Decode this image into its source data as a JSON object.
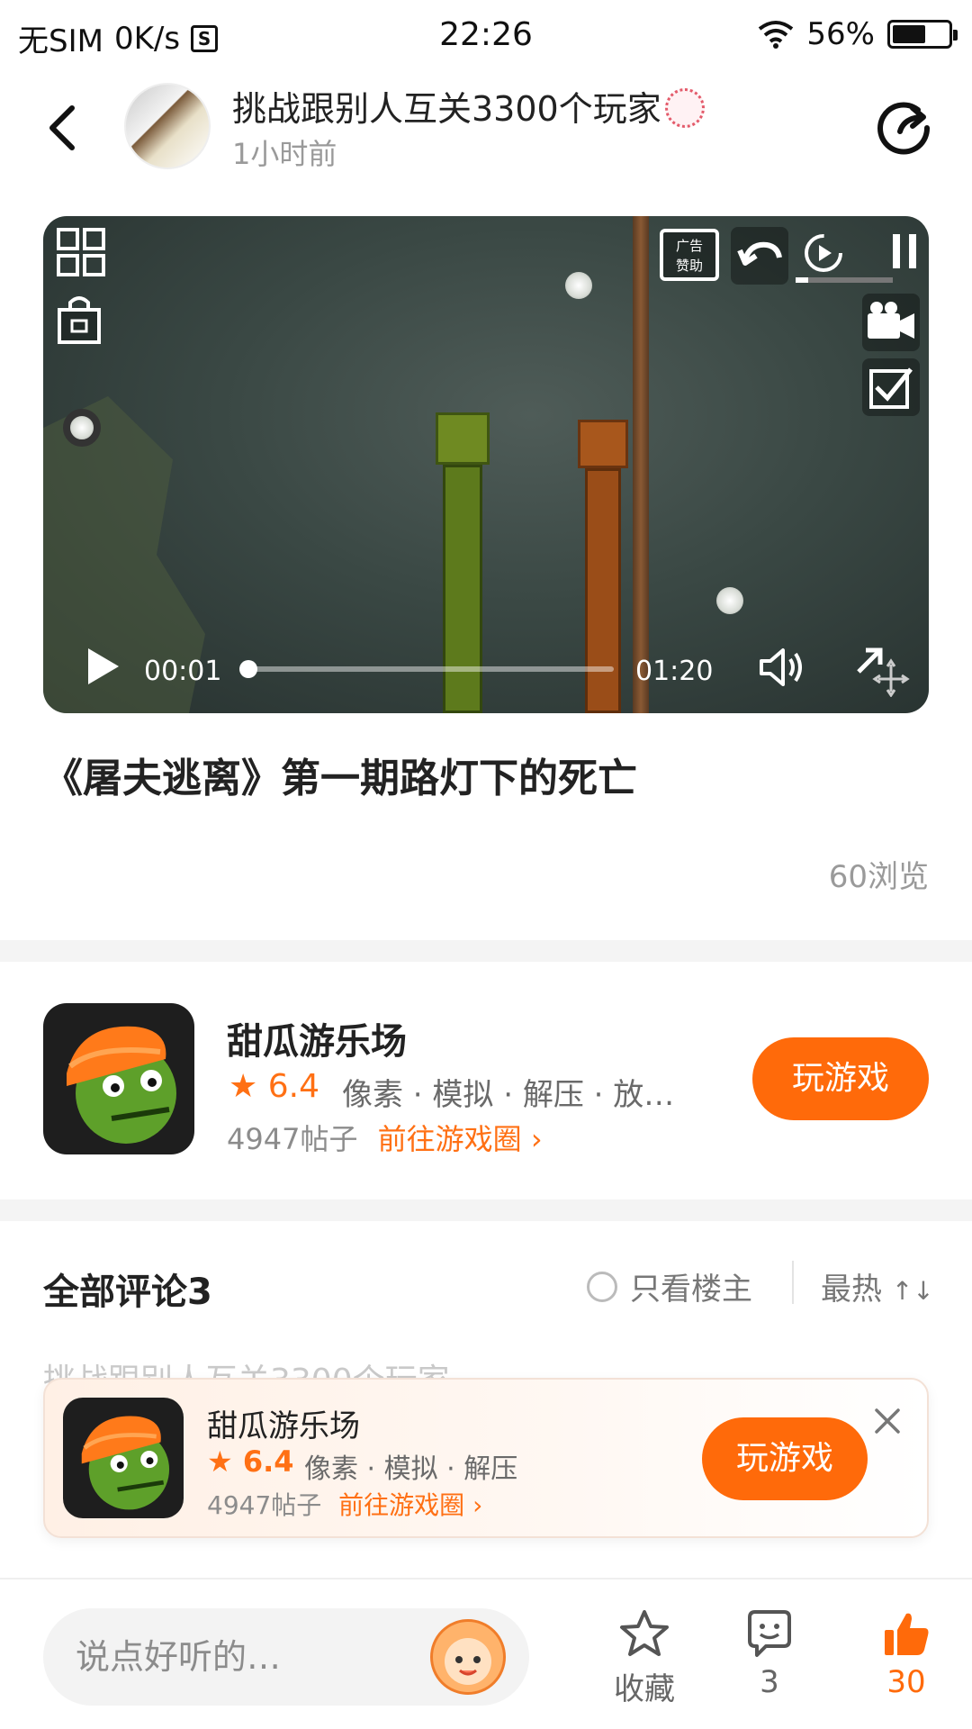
{
  "status_bar": {
    "carrier": "无SIM",
    "speed": "0K/s",
    "sim_icon_text": "S",
    "time": "22:26",
    "battery": "56%"
  },
  "header": {
    "title": "挑战跟别人互关3300个玩家",
    "time_ago": "1小时前"
  },
  "video": {
    "ad_label": "广告\n赞助",
    "current_time": "00:01",
    "duration": "01:20",
    "progress": 0.01
  },
  "post": {
    "title": "《屠夫逃离》第一期路灯下的死亡",
    "views": "60浏览"
  },
  "game_card": {
    "name": "甜瓜游乐场",
    "rating": "6.4",
    "tags": "像素 · 模拟 · 解压 · 放…",
    "posts": "4947帖子",
    "goto": "前往游戏圈",
    "play_label": "玩游戏"
  },
  "comments": {
    "title": "全部评论3",
    "only_host": "只看楼主",
    "sort": "最热",
    "sort_icon": "↑↓",
    "faded_preview": "挑战跟别人互关3300个玩家"
  },
  "banner": {
    "name": "甜瓜游乐场",
    "rating": "6.4",
    "tags": "像素 · 模拟 · 解压",
    "posts": "4947帖子",
    "goto": "前往游戏圈",
    "play_label": "玩游戏"
  },
  "bottom_bar": {
    "input_placeholder": "说点好听的…",
    "favorite_label": "收藏",
    "comment_count": "3",
    "like_count": "30"
  },
  "colors": {
    "accent": "#ff6a0a",
    "text": "#222222",
    "muted": "#9a9a9a"
  }
}
